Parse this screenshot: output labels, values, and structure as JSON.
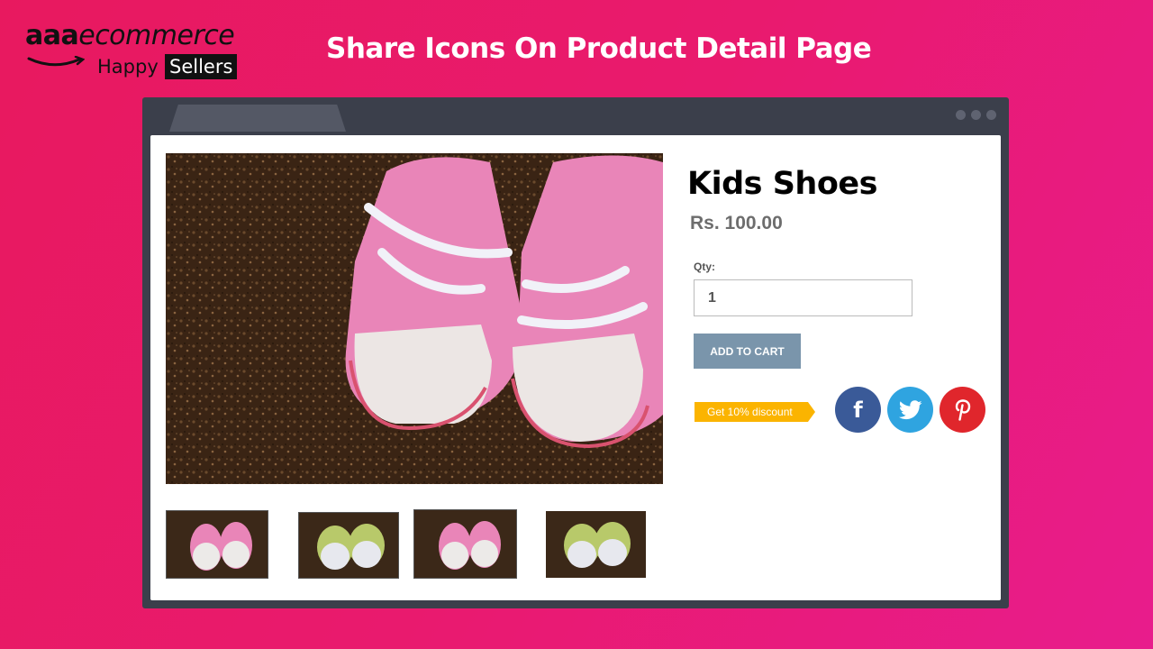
{
  "brand": {
    "name_prefix": "aaa",
    "name_suffix": "ecommerce",
    "tagline_happy": "Happy",
    "tagline_sellers": "Sellers"
  },
  "headline": "Share Icons On Product Detail Page",
  "product": {
    "title": "Kids Shoes",
    "price": "Rs. 100.00",
    "qty_label": "Qty:",
    "qty_value": "1",
    "add_to_cart_label": "ADD TO CART"
  },
  "promo": {
    "discount_label": "Get 10% discount"
  },
  "share": {
    "facebook_letter": "f",
    "icons": [
      "facebook-icon",
      "twitter-icon",
      "pinterest-icon"
    ],
    "colors": {
      "facebook": "#3a5a98",
      "twitter": "#2fa4e0",
      "pinterest": "#e0262c"
    }
  },
  "theme": {
    "background": "#e8195f",
    "button": "#7a95ab",
    "badge": "#fbb400"
  }
}
